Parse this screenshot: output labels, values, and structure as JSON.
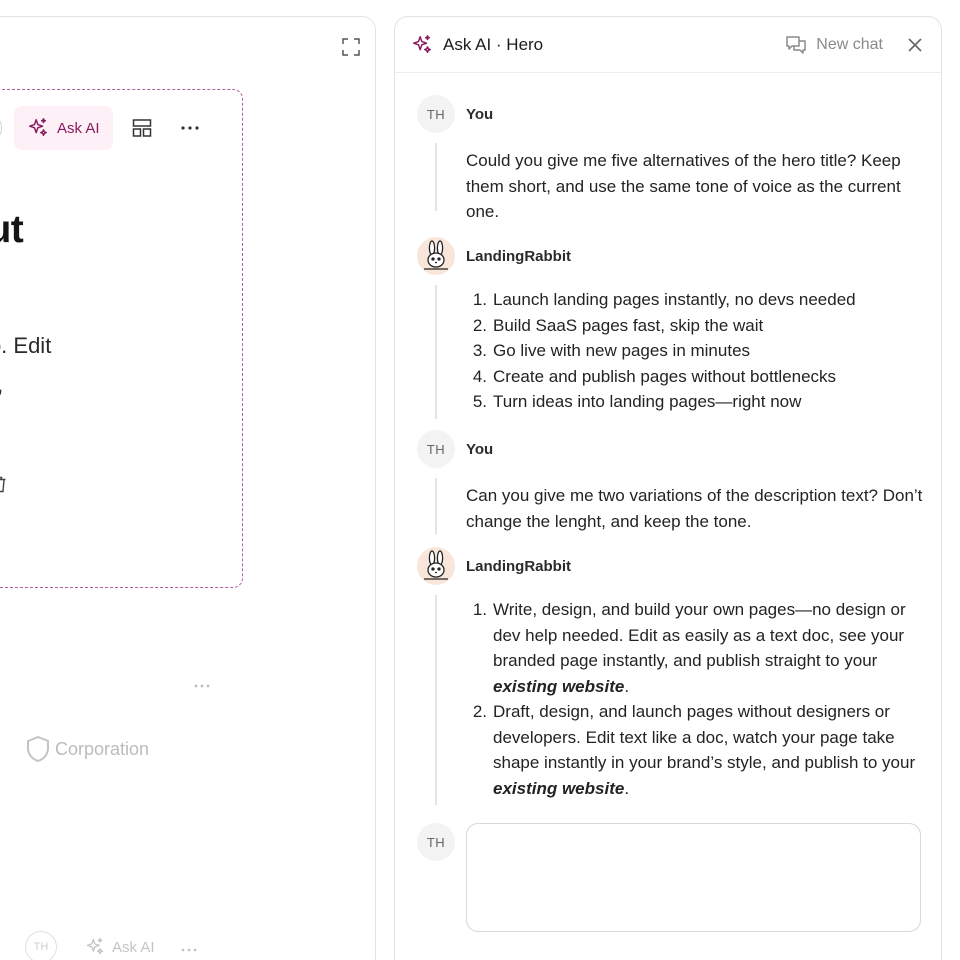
{
  "editor": {
    "ask_ai_label": "Ask AI",
    "hero_title": "ithout",
    "hero_desc": "dev help. Edit\ninstantly,",
    "corp_label": "Corporation",
    "bottom_avatar": "TH",
    "bottom_ask_label": "Ask AI",
    "more_label": "···"
  },
  "chat": {
    "title": "Ask AI · Hero",
    "new_chat_label": "New chat",
    "messages": [
      {
        "initials": "TH",
        "sender": "You",
        "text": "Could you give me five alternatives of the hero title? Keep them short, and use the same tone of voice as the current one."
      },
      {
        "sender": "LandingRabbit",
        "items": [
          "Launch landing pages instantly, no devs needed",
          "Build SaaS pages fast, skip the wait",
          "Go live with new pages in minutes",
          "Create and publish pages without bottlenecks",
          "Turn ideas into landing pages—right now"
        ]
      },
      {
        "initials": "TH",
        "sender": "You",
        "text": "Can you give me two variations of the description text? Don’t change the lenght, and keep the tone."
      },
      {
        "sender": "LandingRabbit",
        "items": [
          {
            "pre": "Write, design, and build your own pages—no design or dev help needed. Edit as easily as a text doc, see your branded page instantly, and publish straight to your ",
            "em": "existing website",
            "post": "."
          },
          {
            "pre": "Draft, design, and launch pages without designers or developers. Edit text like a doc, watch your page take shape instantly in your brand’s style, and publish to your ",
            "em": "existing website",
            "post": "."
          }
        ]
      }
    ],
    "composer": {
      "initials": "TH",
      "value": ""
    }
  },
  "colors": {
    "accent": "#8a1a5f",
    "accent_bg": "#fdf0f6",
    "dashed_border": "#b25ca9"
  }
}
